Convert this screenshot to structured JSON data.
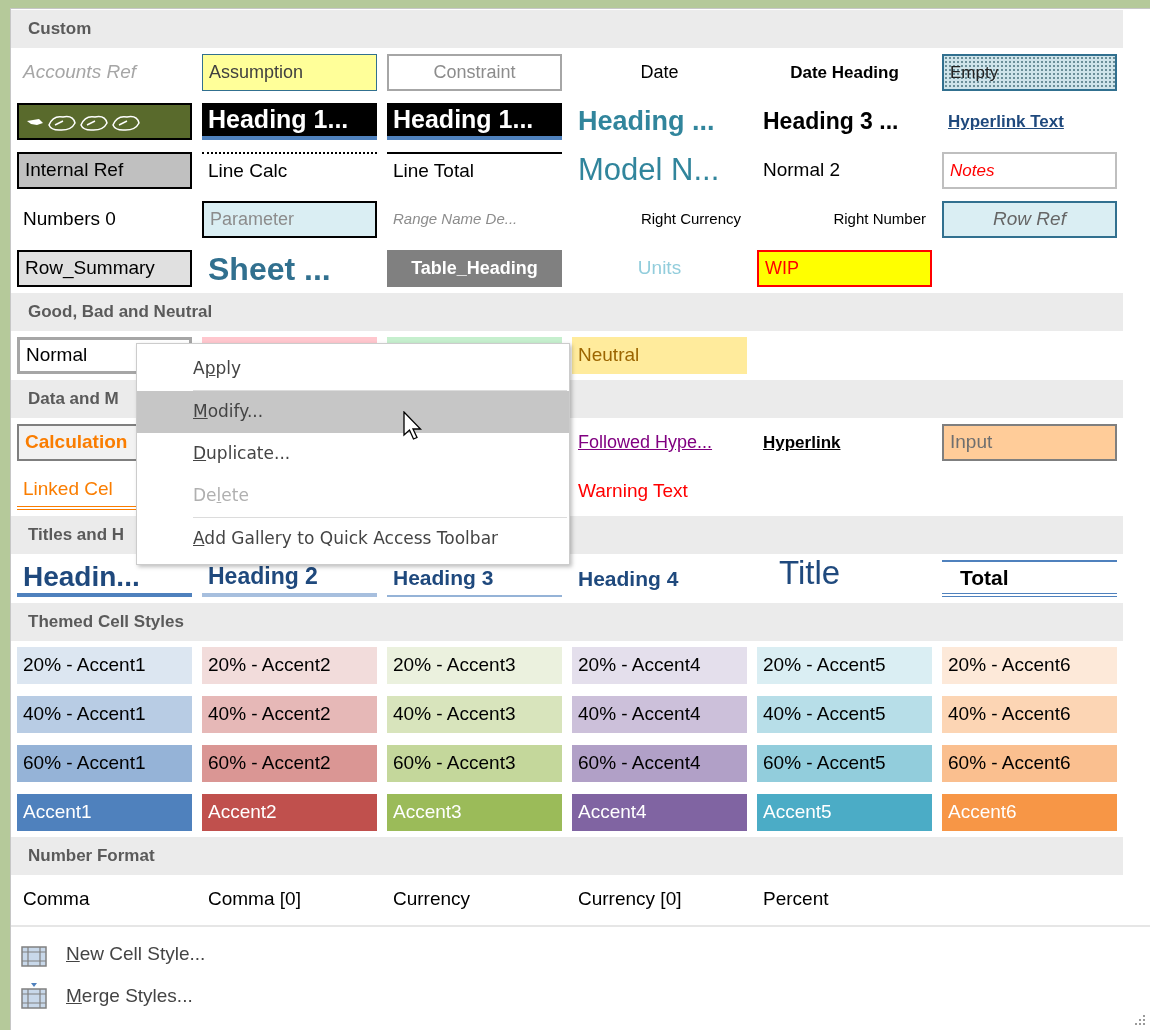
{
  "sections": [
    {
      "title": "Custom",
      "rows": [
        [
          {
            "label": "Accounts Ref",
            "kind": "accounts-ref"
          },
          {
            "label": "Assumption",
            "kind": "assumption"
          },
          {
            "label": "Constraint",
            "kind": "constraint"
          },
          {
            "label": "Date",
            "kind": "date"
          },
          {
            "label": "Date Heading",
            "kind": "date-heading"
          },
          {
            "label": "Empty",
            "kind": "empty"
          }
        ],
        [
          {
            "kind": "symbols"
          },
          {
            "label": "Heading 1...",
            "kind": "heading-black"
          },
          {
            "label": "Heading 1...",
            "kind": "heading-black"
          },
          {
            "label": "Heading ...",
            "kind": "heading-teal"
          },
          {
            "label": "Heading 3 ...",
            "kind": "heading-bold"
          },
          {
            "label": "Hyperlink Text",
            "kind": "hyperlink-text"
          }
        ],
        [
          {
            "label": "Internal Ref",
            "kind": "internal-ref"
          },
          {
            "label": "Line Calc",
            "kind": "line-calc"
          },
          {
            "label": "Line Total",
            "kind": "line-total"
          },
          {
            "label": "Model N...",
            "kind": "model-name"
          },
          {
            "label": "Normal 2",
            "kind": "plain"
          },
          {
            "label": "Notes",
            "kind": "notes"
          }
        ],
        [
          {
            "label": "Numbers 0",
            "kind": "plain"
          },
          {
            "label": "Parameter",
            "kind": "parameter"
          },
          {
            "label": "Range Name De...",
            "kind": "range-name"
          },
          {
            "label": "Right Currency",
            "kind": "right"
          },
          {
            "label": "Right Number",
            "kind": "right"
          },
          {
            "label": "Row Ref",
            "kind": "row-ref"
          }
        ],
        [
          {
            "label": "Row_Summary",
            "kind": "row-summary"
          },
          {
            "label": "Sheet ...",
            "kind": "sheet-title"
          },
          {
            "label": "Table_Heading",
            "kind": "table-heading"
          },
          {
            "label": "Units",
            "kind": "units"
          },
          {
            "label": "WIP",
            "kind": "wip"
          },
          null
        ]
      ]
    },
    {
      "title": "Good, Bad and Neutral",
      "rows": [
        [
          {
            "label": "Normal",
            "kind": "normal"
          },
          {
            "kind": "bad"
          },
          {
            "kind": "good"
          },
          {
            "label": "Neutral",
            "kind": "neutral"
          },
          null,
          null
        ]
      ]
    },
    {
      "title": "Data and M",
      "rows": [
        [
          {
            "label": "Calculation",
            "kind": "calculation"
          },
          null,
          null,
          {
            "label": "Followed Hype...",
            "kind": "followed"
          },
          {
            "label": "Hyperlink",
            "kind": "hyperlink"
          },
          {
            "label": "Input",
            "kind": "input"
          }
        ],
        [
          {
            "label": "Linked Cel",
            "kind": "linked"
          },
          null,
          null,
          {
            "label": "Warning Text",
            "kind": "warning"
          },
          null,
          null
        ]
      ]
    },
    {
      "title": "Titles and H",
      "rows": [
        [
          {
            "label": "Headin...",
            "kind": "h1"
          },
          {
            "label": "Heading 2",
            "kind": "h2"
          },
          {
            "label": "Heading 3",
            "kind": "h3"
          },
          {
            "label": "Heading 4",
            "kind": "h4"
          },
          {
            "label": "Title",
            "kind": "title"
          },
          {
            "label": "Total",
            "kind": "total"
          }
        ]
      ]
    },
    {
      "title": "Themed Cell Styles",
      "rows": [
        [
          {
            "label": "20% - Accent1",
            "kind": "tint",
            "color": "#dce6f1"
          },
          {
            "label": "20% - Accent2",
            "kind": "tint",
            "color": "#f2dcdb"
          },
          {
            "label": "20% - Accent3",
            "kind": "tint",
            "color": "#ebf1de"
          },
          {
            "label": "20% - Accent4",
            "kind": "tint",
            "color": "#e4dfec"
          },
          {
            "label": "20% - Accent5",
            "kind": "tint",
            "color": "#daeef3"
          },
          {
            "label": "20% - Accent6",
            "kind": "tint",
            "color": "#fde9d9"
          }
        ],
        [
          {
            "label": "40% - Accent1",
            "kind": "tint",
            "color": "#b8cce4"
          },
          {
            "label": "40% - Accent2",
            "kind": "tint",
            "color": "#e6b8b7"
          },
          {
            "label": "40% - Accent3",
            "kind": "tint",
            "color": "#d8e4bc"
          },
          {
            "label": "40% - Accent4",
            "kind": "tint",
            "color": "#ccc0da"
          },
          {
            "label": "40% - Accent5",
            "kind": "tint",
            "color": "#b7dee8"
          },
          {
            "label": "40% - Accent6",
            "kind": "tint",
            "color": "#fcd5b4"
          }
        ],
        [
          {
            "label": "60% - Accent1",
            "kind": "tint",
            "color": "#95b3d7"
          },
          {
            "label": "60% - Accent2",
            "kind": "tint",
            "color": "#da9694"
          },
          {
            "label": "60% - Accent3",
            "kind": "tint",
            "color": "#c4d79b"
          },
          {
            "label": "60% - Accent4",
            "kind": "tint",
            "color": "#b1a0c7"
          },
          {
            "label": "60% - Accent5",
            "kind": "tint",
            "color": "#92cddc"
          },
          {
            "label": "60% - Accent6",
            "kind": "tint",
            "color": "#fabf8f"
          }
        ],
        [
          {
            "label": "Accent1",
            "kind": "solid",
            "color": "#4f81bd"
          },
          {
            "label": "Accent2",
            "kind": "solid",
            "color": "#c0504d"
          },
          {
            "label": "Accent3",
            "kind": "solid",
            "color": "#9bbb59"
          },
          {
            "label": "Accent4",
            "kind": "solid",
            "color": "#8064a2"
          },
          {
            "label": "Accent5",
            "kind": "solid",
            "color": "#4bacc6"
          },
          {
            "label": "Accent6",
            "kind": "solid",
            "color": "#f79646"
          }
        ]
      ]
    },
    {
      "title": "Number Format",
      "rows": [
        [
          {
            "label": "Comma",
            "kind": "plain"
          },
          {
            "label": "Comma [0]",
            "kind": "plain"
          },
          {
            "label": "Currency",
            "kind": "plain"
          },
          {
            "label": "Currency [0]",
            "kind": "plain"
          },
          {
            "label": "Percent",
            "kind": "plain"
          },
          null
        ]
      ]
    }
  ],
  "context_menu": [
    {
      "kind": "item",
      "label_parts": [
        {
          "text": "A",
          "underlined": false
        },
        {
          "text": "p",
          "underlined": true
        },
        {
          "text": "ply",
          "underlined": false
        }
      ],
      "selected": false,
      "disabled": false
    },
    {
      "kind": "separator"
    },
    {
      "kind": "item",
      "label_parts": [
        {
          "text": "M",
          "underlined": true
        },
        {
          "text": "odify...",
          "underlined": false
        }
      ],
      "selected": true,
      "disabled": false
    },
    {
      "kind": "item",
      "label_parts": [
        {
          "text": "D",
          "underlined": true
        },
        {
          "text": "uplicate...",
          "underlined": false
        }
      ],
      "selected": false,
      "disabled": false
    },
    {
      "kind": "item",
      "label_parts": [
        {
          "text": "De",
          "underlined": false
        },
        {
          "text": "l",
          "underlined": true
        },
        {
          "text": "ete",
          "underlined": false
        }
      ],
      "selected": false,
      "disabled": true
    },
    {
      "kind": "separator"
    },
    {
      "kind": "item",
      "label_parts": [
        {
          "text": "A",
          "underlined": true
        },
        {
          "text": "dd Gallery to Quick Access Toolbar",
          "underlined": false
        }
      ],
      "selected": false,
      "disabled": false
    }
  ],
  "footer": [
    {
      "kind": "new",
      "label_parts": [
        {
          "text": "N",
          "underlined": true
        },
        {
          "text": "ew Cell Style...",
          "underlined": false
        }
      ]
    },
    {
      "kind": "merge",
      "label_parts": [
        {
          "text": "M",
          "underlined": true
        },
        {
          "text": "erge Styles...",
          "underlined": false
        }
      ]
    }
  ]
}
